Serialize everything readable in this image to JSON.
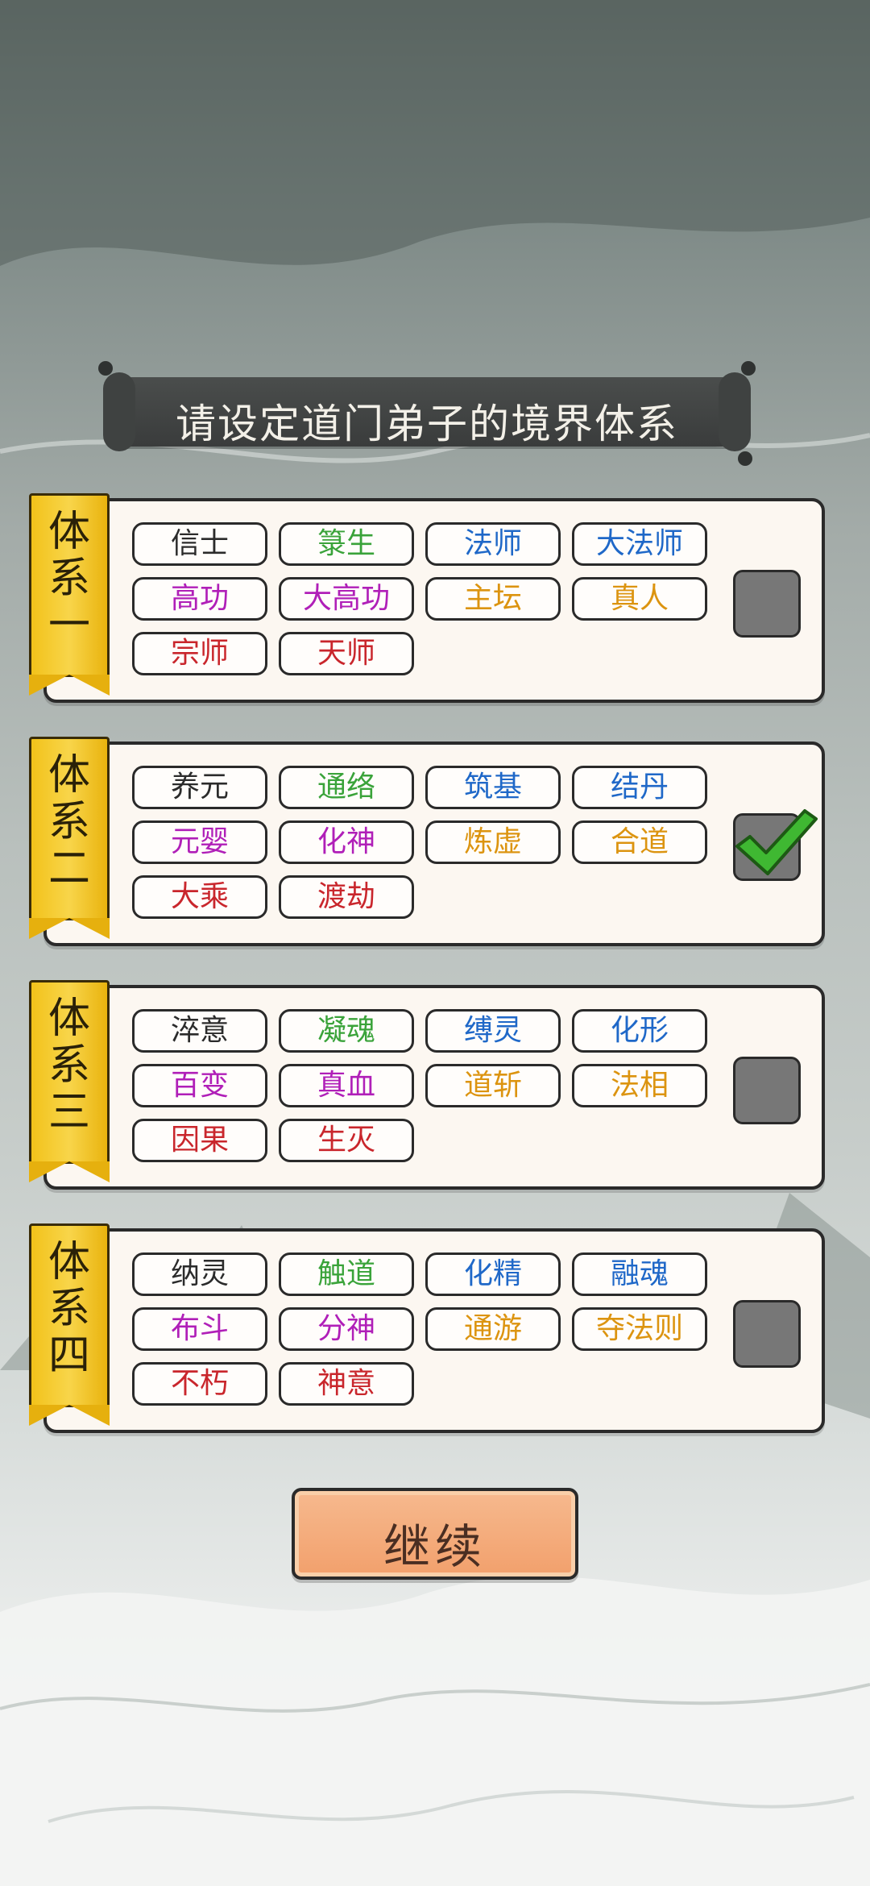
{
  "title": "请设定道门弟子的境界体系",
  "systems": [
    {
      "label": "体\n系\n一",
      "checked": false,
      "tags": [
        {
          "text": "信士",
          "color": "black"
        },
        {
          "text": "箓生",
          "color": "green"
        },
        {
          "text": "法师",
          "color": "blue"
        },
        {
          "text": "大法师",
          "color": "blue"
        },
        {
          "text": "高功",
          "color": "purple"
        },
        {
          "text": "大高功",
          "color": "purple"
        },
        {
          "text": "主坛",
          "color": "orange"
        },
        {
          "text": "真人",
          "color": "orange"
        },
        {
          "text": "宗师",
          "color": "red"
        },
        {
          "text": "天师",
          "color": "red"
        }
      ]
    },
    {
      "label": "体\n系\n二",
      "checked": true,
      "tags": [
        {
          "text": "养元",
          "color": "black"
        },
        {
          "text": "通络",
          "color": "green"
        },
        {
          "text": "筑基",
          "color": "blue"
        },
        {
          "text": "结丹",
          "color": "blue"
        },
        {
          "text": "元婴",
          "color": "purple"
        },
        {
          "text": "化神",
          "color": "purple"
        },
        {
          "text": "炼虚",
          "color": "orange"
        },
        {
          "text": "合道",
          "color": "orange"
        },
        {
          "text": "大乘",
          "color": "red"
        },
        {
          "text": "渡劫",
          "color": "red"
        }
      ]
    },
    {
      "label": "体\n系\n三",
      "checked": false,
      "tags": [
        {
          "text": "淬意",
          "color": "black"
        },
        {
          "text": "凝魂",
          "color": "green"
        },
        {
          "text": "缚灵",
          "color": "blue"
        },
        {
          "text": "化形",
          "color": "blue"
        },
        {
          "text": "百变",
          "color": "purple"
        },
        {
          "text": "真血",
          "color": "purple"
        },
        {
          "text": "道斩",
          "color": "orange"
        },
        {
          "text": "法相",
          "color": "orange"
        },
        {
          "text": "因果",
          "color": "red"
        },
        {
          "text": "生灭",
          "color": "red"
        }
      ]
    },
    {
      "label": "体\n系\n四",
      "checked": false,
      "tags": [
        {
          "text": "纳灵",
          "color": "black"
        },
        {
          "text": "触道",
          "color": "green"
        },
        {
          "text": "化精",
          "color": "blue"
        },
        {
          "text": "融魂",
          "color": "blue"
        },
        {
          "text": "布斗",
          "color": "purple"
        },
        {
          "text": "分神",
          "color": "purple"
        },
        {
          "text": "通游",
          "color": "orange"
        },
        {
          "text": "夺法则",
          "color": "orange"
        },
        {
          "text": "不朽",
          "color": "red"
        },
        {
          "text": "神意",
          "color": "red"
        }
      ]
    }
  ],
  "continue_label": "继续",
  "colors": {
    "checkbox_gray": "#777777",
    "check_green": "#3fb832",
    "ribbon_gold": "#f2c21a",
    "button_orange": "#f2a06c"
  }
}
